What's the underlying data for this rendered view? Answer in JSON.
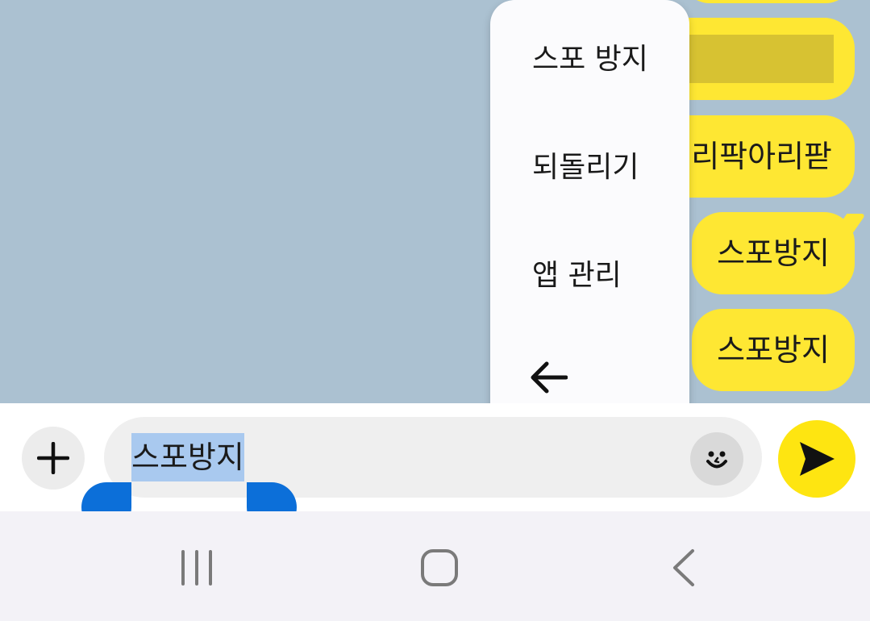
{
  "chat": {
    "messages": [
      {
        "text": ""
      },
      {
        "text": ""
      },
      {
        "text": "리팍아리팓"
      },
      {
        "text": "스포방지"
      },
      {
        "text": "스포방지"
      }
    ]
  },
  "context_menu": {
    "items": [
      {
        "label": "스포 방지"
      },
      {
        "label": "되돌리기"
      },
      {
        "label": "앱 관리"
      }
    ],
    "back_icon": "arrow-left-icon"
  },
  "input": {
    "value": "스포방지",
    "selected_text": "스포방지",
    "plus_icon": "plus-icon",
    "emoji_icon": "emoji-icon",
    "send_icon": "send-icon"
  },
  "nav_bar": {
    "recent_icon": "recent-apps-icon",
    "home_icon": "home-icon",
    "back_icon": "back-icon"
  },
  "colors": {
    "chat_background": "#abc1d1",
    "bubble": "#fee733",
    "send_button": "#fee511",
    "selection": "#a9c9ef",
    "selection_handle": "#0c6fd9"
  }
}
